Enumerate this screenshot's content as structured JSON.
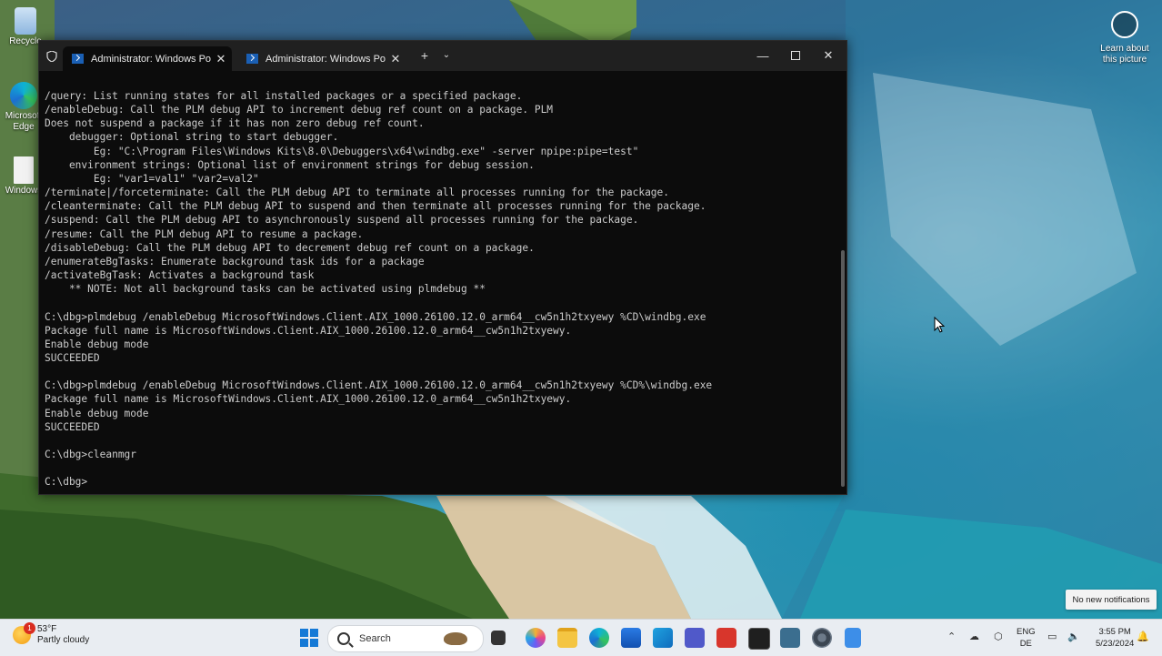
{
  "desktop": {
    "icons": [
      {
        "label": "Recycle",
        "icon": "recycle-bin-icon"
      },
      {
        "label": "Microsoft Edge",
        "icon": "edge-icon"
      },
      {
        "label": "Windows",
        "icon": "document-icon"
      }
    ],
    "learn_about": "Learn about this picture"
  },
  "terminal": {
    "tabs": [
      {
        "label": "Administrator: Windows Powe",
        "active": true
      },
      {
        "label": "Administrator: Windows Powe",
        "active": false
      }
    ],
    "lines": [
      "/query: List running states for all installed packages or a specified package.",
      "/enableDebug: Call the PLM debug API to increment debug ref count on a package. PLM",
      "Does not suspend a package if it has non zero debug ref count.",
      "    debugger: Optional string to start debugger.",
      "        Eg: \"C:\\Program Files\\Windows Kits\\8.0\\Debuggers\\x64\\windbg.exe\" -server npipe:pipe=test\"",
      "    environment strings: Optional list of environment strings for debug session.",
      "        Eg: \"var1=val1\" \"var2=val2\"",
      "/terminate|/forceterminate: Call the PLM debug API to terminate all processes running for the package.",
      "/cleanterminate: Call the PLM debug API to suspend and then terminate all processes running for the package.",
      "/suspend: Call the PLM debug API to asynchronously suspend all processes running for the package.",
      "/resume: Call the PLM debug API to resume a package.",
      "/disableDebug: Call the PLM debug API to decrement debug ref count on a package.",
      "/enumerateBgTasks: Enumerate background task ids for a package",
      "/activateBgTask: Activates a background task",
      "    ** NOTE: Not all background tasks can be activated using plmdebug **",
      "",
      "C:\\dbg>plmdebug /enableDebug MicrosoftWindows.Client.AIX_1000.26100.12.0_arm64__cw5n1h2txyewy %CD\\windbg.exe",
      "Package full name is MicrosoftWindows.Client.AIX_1000.26100.12.0_arm64__cw5n1h2txyewy.",
      "Enable debug mode",
      "SUCCEEDED",
      "",
      "C:\\dbg>plmdebug /enableDebug MicrosoftWindows.Client.AIX_1000.26100.12.0_arm64__cw5n1h2txyewy %CD%\\windbg.exe",
      "Package full name is MicrosoftWindows.Client.AIX_1000.26100.12.0_arm64__cw5n1h2txyewy.",
      "Enable debug mode",
      "SUCCEEDED",
      "",
      "C:\\dbg>cleanmgr",
      "",
      "C:\\dbg>"
    ]
  },
  "notification": "No new notifications",
  "taskbar": {
    "weather": {
      "temp": "53°F",
      "condition": "Partly cloudy",
      "badge": "1"
    },
    "search_label": "Search",
    "apps": [
      "start-icon",
      "task-view-icon",
      "copilot-icon",
      "file-explorer-icon",
      "edge-icon",
      "store-icon",
      "photos-icon",
      "teams-icon",
      "app-red-icon",
      "terminal-icon",
      "app-icon",
      "settings-icon",
      "notepad-icon"
    ],
    "lang": {
      "line1": "ENG",
      "line2": "DE"
    },
    "clock": {
      "time": "3:55 PM",
      "date": "5/23/2024"
    }
  },
  "colors": {
    "console_bg": "#0c0c0c",
    "console_fg": "#cccccc",
    "titlebar": "#202020",
    "taskbar": "#e9edf2"
  }
}
